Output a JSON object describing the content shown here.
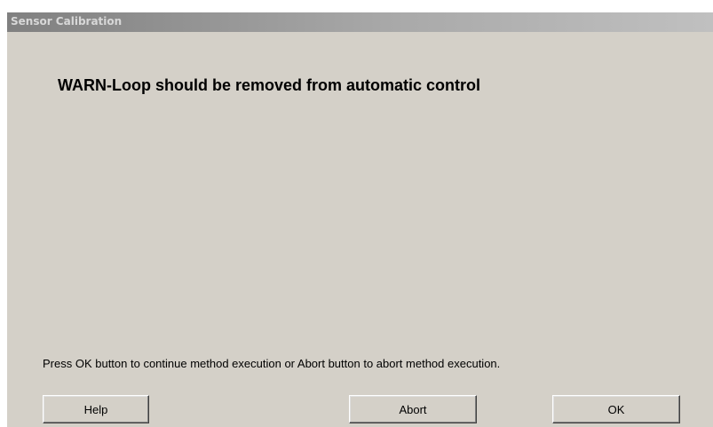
{
  "window": {
    "title": "Sensor Calibration"
  },
  "message": {
    "warning": "WARN-Loop should be removed from automatic control",
    "instruction": "Press OK button to continue method execution or Abort button to abort method execution."
  },
  "buttons": {
    "help_label": "Help",
    "abort_label": "Abort",
    "ok_label": "OK"
  },
  "colors": {
    "dialog_background": "#d4d0c8",
    "titlebar_start": "#808080",
    "titlebar_end": "#c0c0c0"
  }
}
